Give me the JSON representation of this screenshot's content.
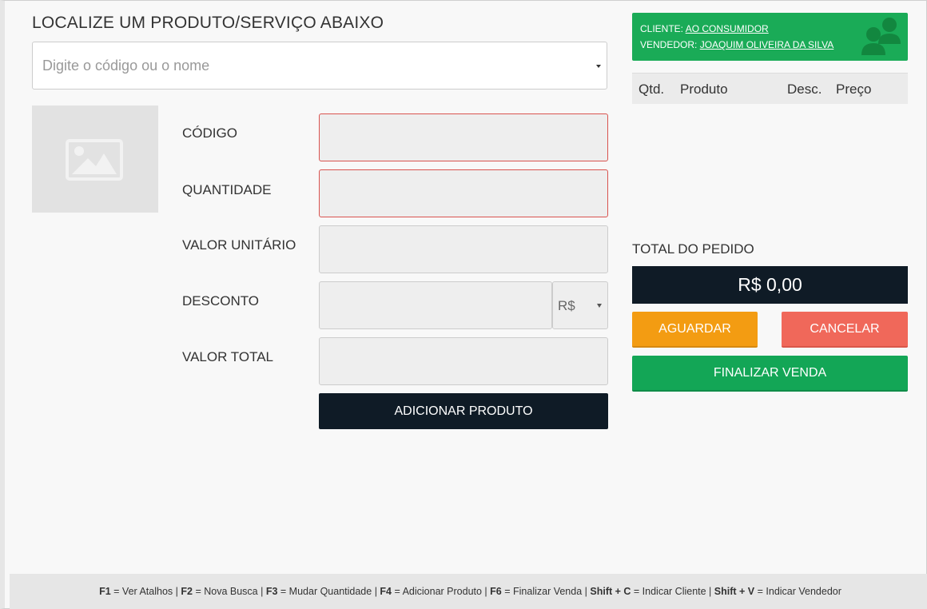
{
  "search": {
    "title": "LOCALIZE UM PRODUTO/SERVIÇO ABAIXO",
    "placeholder": "Digite o código ou o nome"
  },
  "form": {
    "code_label": "CÓDIGO",
    "quantity_label": "QUANTIDADE",
    "unit_value_label": "VALOR UNITÁRIO",
    "discount_label": "DESCONTO",
    "total_value_label": "VALOR TOTAL",
    "currency_option": "R$",
    "add_button": "ADICIONAR PRODUTO"
  },
  "client": {
    "client_label": "CLIENTE:",
    "client_name": "AO CONSUMIDOR",
    "seller_label": "VENDEDOR:",
    "seller_name": "JOAQUIM OLIVEIRA DA SILVA"
  },
  "cart": {
    "columns": [
      "Qtd.",
      "Produto",
      "Desc.",
      "Preço"
    ]
  },
  "order": {
    "total_label": "TOTAL DO PEDIDO",
    "total_value": "R$ 0,00",
    "wait_button": "AGUARDAR",
    "cancel_button": "CANCELAR",
    "finish_button": "FINALIZAR VENDA"
  },
  "shortcuts": [
    {
      "key": "F1",
      "action": "Ver Atalhos"
    },
    {
      "key": "F2",
      "action": "Nova Busca"
    },
    {
      "key": "F3",
      "action": "Mudar Quantidade"
    },
    {
      "key": "F4",
      "action": "Adicionar Produto"
    },
    {
      "key": "F6",
      "action": "Finalizar Venda"
    },
    {
      "key": "Shift + C",
      "action": "Indicar Cliente"
    },
    {
      "key": "Shift + V",
      "action": "Indicar Vendedor"
    }
  ],
  "colors": {
    "client_box": "#1aab57",
    "dark": "#0f1b26",
    "wait": "#f39c12",
    "cancel": "#f0685a",
    "finish": "#13a656",
    "error_border": "#d9534f"
  }
}
